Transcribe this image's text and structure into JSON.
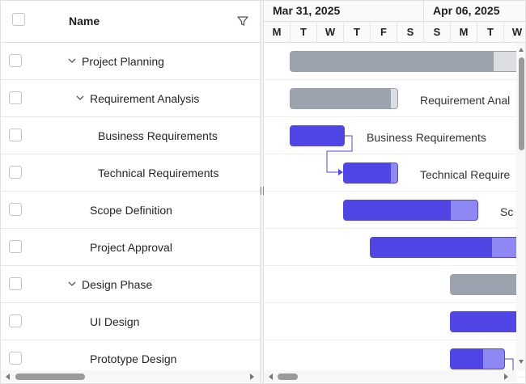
{
  "grid": {
    "header": {
      "name_label": "Name"
    },
    "rows": [
      {
        "label": "Project Planning",
        "expanded": true
      },
      {
        "label": "Requirement Analysis",
        "expanded": true
      },
      {
        "label": "Business Requirements"
      },
      {
        "label": "Technical Requirements"
      },
      {
        "label": "Scope Definition"
      },
      {
        "label": "Project Approval"
      },
      {
        "label": "Design Phase",
        "expanded": true
      },
      {
        "label": "UI Design"
      },
      {
        "label": "Prototype Design"
      }
    ]
  },
  "timeline": {
    "weeks": [
      "Mar 31, 2025",
      "Apr 06, 2025"
    ],
    "days": [
      "M",
      "T",
      "W",
      "T",
      "F",
      "S",
      "S",
      "M",
      "T",
      "W"
    ]
  },
  "tasks": [
    {
      "name": "Project Planning",
      "type": "parent",
      "progress": 0.87,
      "label": ""
    },
    {
      "name": "Requirement Analysis",
      "type": "parent",
      "progress": 0.94,
      "label": "Requirement Anal"
    },
    {
      "name": "Business Requirements",
      "type": "child",
      "progress": 1.0,
      "label": "Business Requirements"
    },
    {
      "name": "Technical Requirements",
      "type": "child",
      "progress": 0.88,
      "label": "Technical Require"
    },
    {
      "name": "Scope Definition",
      "type": "child",
      "progress": 0.8,
      "label": "Sc"
    },
    {
      "name": "Project Approval",
      "type": "child",
      "progress": 0.78,
      "label": ""
    },
    {
      "name": "Design Phase",
      "type": "parent",
      "progress": 1.0,
      "label": ""
    },
    {
      "name": "UI Design",
      "type": "child",
      "progress": 1.0,
      "label": ""
    },
    {
      "name": "Prototype Design",
      "type": "child",
      "progress": 0.6,
      "label": ""
    }
  ],
  "colors": {
    "task_bar": "#4f46e5",
    "task_remaining": "#8e88f5",
    "parent_bar": "#9ca2ae",
    "parent_remaining": "#dcdde1"
  }
}
